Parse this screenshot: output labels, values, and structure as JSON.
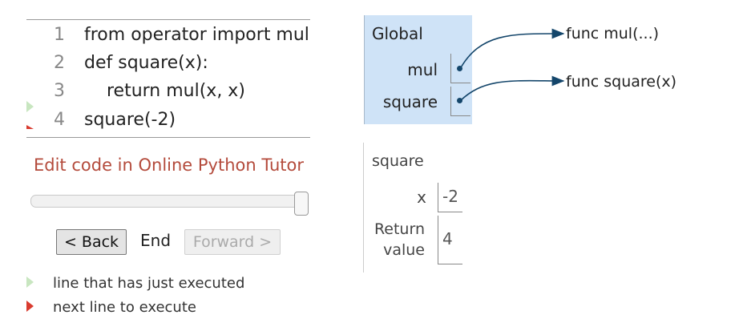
{
  "code": {
    "lines": [
      {
        "num": "1",
        "text": "from operator import mul"
      },
      {
        "num": "2",
        "text": "def square(x):"
      },
      {
        "num": "3",
        "text": "    return mul(x, x)"
      },
      {
        "num": "4",
        "text": "square(-2)"
      }
    ]
  },
  "controls": {
    "edit_link": "Edit code in Online Python Tutor",
    "back_label": "< Back",
    "end_label": "End",
    "forward_label": "Forward >",
    "slider_position": 1.0
  },
  "legend": {
    "just_executed": "line that has just executed",
    "next_line": "next line to execute"
  },
  "global_frame": {
    "title": "Global",
    "vars": [
      {
        "name": "mul",
        "points_to": "func mul(...)"
      },
      {
        "name": "square",
        "points_to": "func square(x)"
      }
    ]
  },
  "square_frame": {
    "title": "square",
    "x_name": "x",
    "x_value": "-2",
    "return_name_1": "Return",
    "return_name_2": "value",
    "return_value": "4"
  },
  "colors": {
    "green_marker": "#c8e6c0",
    "red_marker": "#d93b2f",
    "link": "#b44b3c",
    "frame_bg": "#cfe3f7",
    "pointer": "#14466b"
  }
}
